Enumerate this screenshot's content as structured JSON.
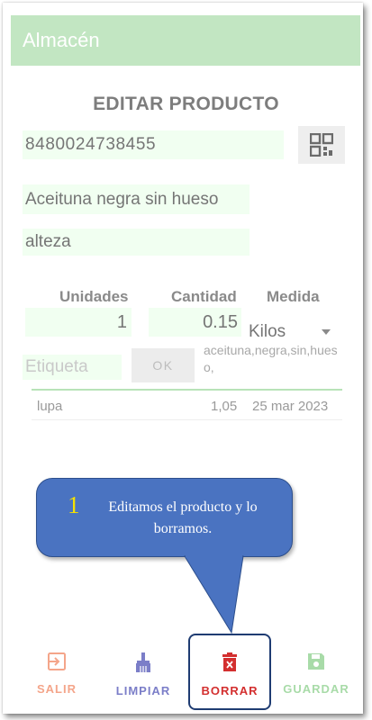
{
  "appbar": {
    "title": "Almacén"
  },
  "heading": "EDITAR PRODUCTO",
  "product": {
    "barcode": "8480024738455",
    "name": "Aceituna negra sin hueso",
    "brand": "alteza"
  },
  "columns": {
    "units": "Unidades",
    "quantity": "Cantidad",
    "measure": "Medida"
  },
  "values": {
    "units": "1",
    "quantity": "0.15",
    "measure": "Kilos"
  },
  "tag": {
    "placeholder": "Etiqueta",
    "ok_label": "OK",
    "tags": "aceituna,negra,sin,hueso,"
  },
  "history": [
    {
      "store": "lupa",
      "price": "1,05",
      "date": "25 mar 2023"
    }
  ],
  "callout": {
    "number": "1",
    "text": "Editamos el producto y lo borramos."
  },
  "nav": {
    "salir": "SALIR",
    "limpiar": "LIMPIAR",
    "borrar": "BORRAR",
    "guardar": "GUARDAR"
  },
  "colors": {
    "appbar": "#c2e6c2",
    "salir": "#f4a58a",
    "limpiar": "#7b7ec8",
    "borrar": "#d32f2f",
    "guardar": "#a8dba8",
    "callout": "#4a73c1"
  },
  "icons": {
    "qr": "qr-code-icon",
    "salir": "exit-icon",
    "limpiar": "broom-icon",
    "borrar": "trash-icon",
    "guardar": "save-icon"
  }
}
